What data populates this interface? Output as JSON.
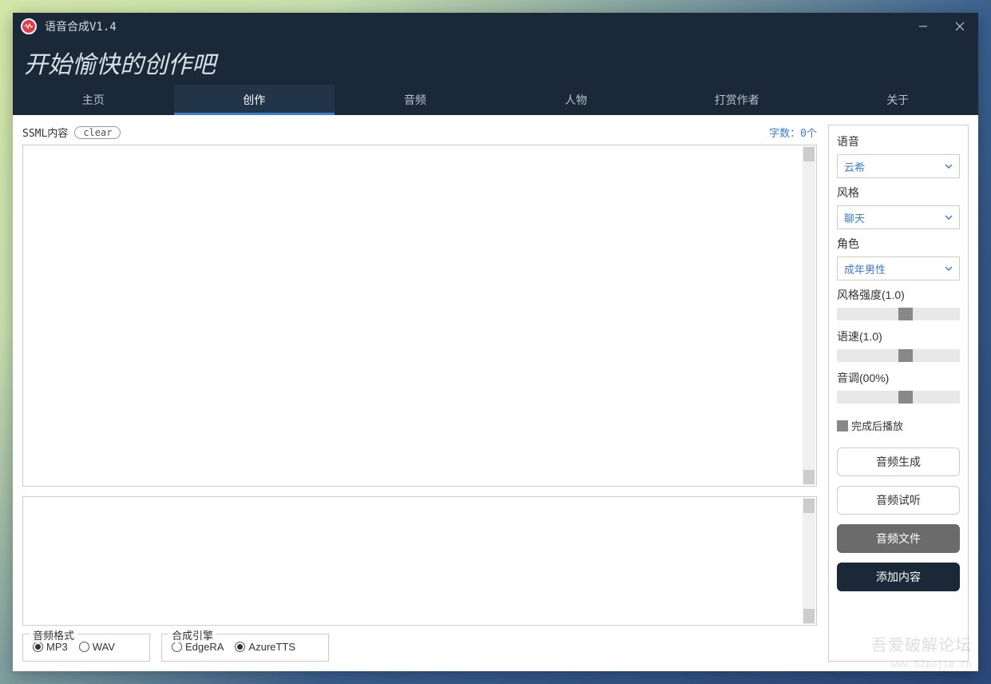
{
  "titlebar": {
    "title": "语音合成V1.4"
  },
  "header": {
    "slogan": "开始愉快的创作吧"
  },
  "tabs": [
    {
      "label": "主页"
    },
    {
      "label": "创作"
    },
    {
      "label": "音频"
    },
    {
      "label": "人物"
    },
    {
      "label": "打赏作者"
    },
    {
      "label": "关于"
    }
  ],
  "ssml": {
    "label": "SSML内容",
    "clear": "clear",
    "char_count": "字数：0个"
  },
  "format_group": {
    "legend": "音频格式",
    "mp3": "MP3",
    "wav": "WAV",
    "selected": "mp3"
  },
  "engine_group": {
    "legend": "合成引擎",
    "edge": "EdgeRA",
    "azure": "AzureTTS",
    "selected": "azure"
  },
  "side": {
    "voice_label": "语音",
    "voice_value": "云希",
    "style_label": "风格",
    "style_value": "聊天",
    "role_label": "角色",
    "role_value": "成年男性",
    "intensity_label": "风格强度(1.0)",
    "rate_label": "语速(1.0)",
    "pitch_label": "音调(00%)",
    "autoplay_label": "完成后播放",
    "btn_generate": "音频生成",
    "btn_preview": "音频试听",
    "btn_file": "音频文件",
    "btn_add": "添加内容"
  },
  "watermark": {
    "main": "吾爱破解论坛",
    "sub": "www.52pojie.cn"
  }
}
